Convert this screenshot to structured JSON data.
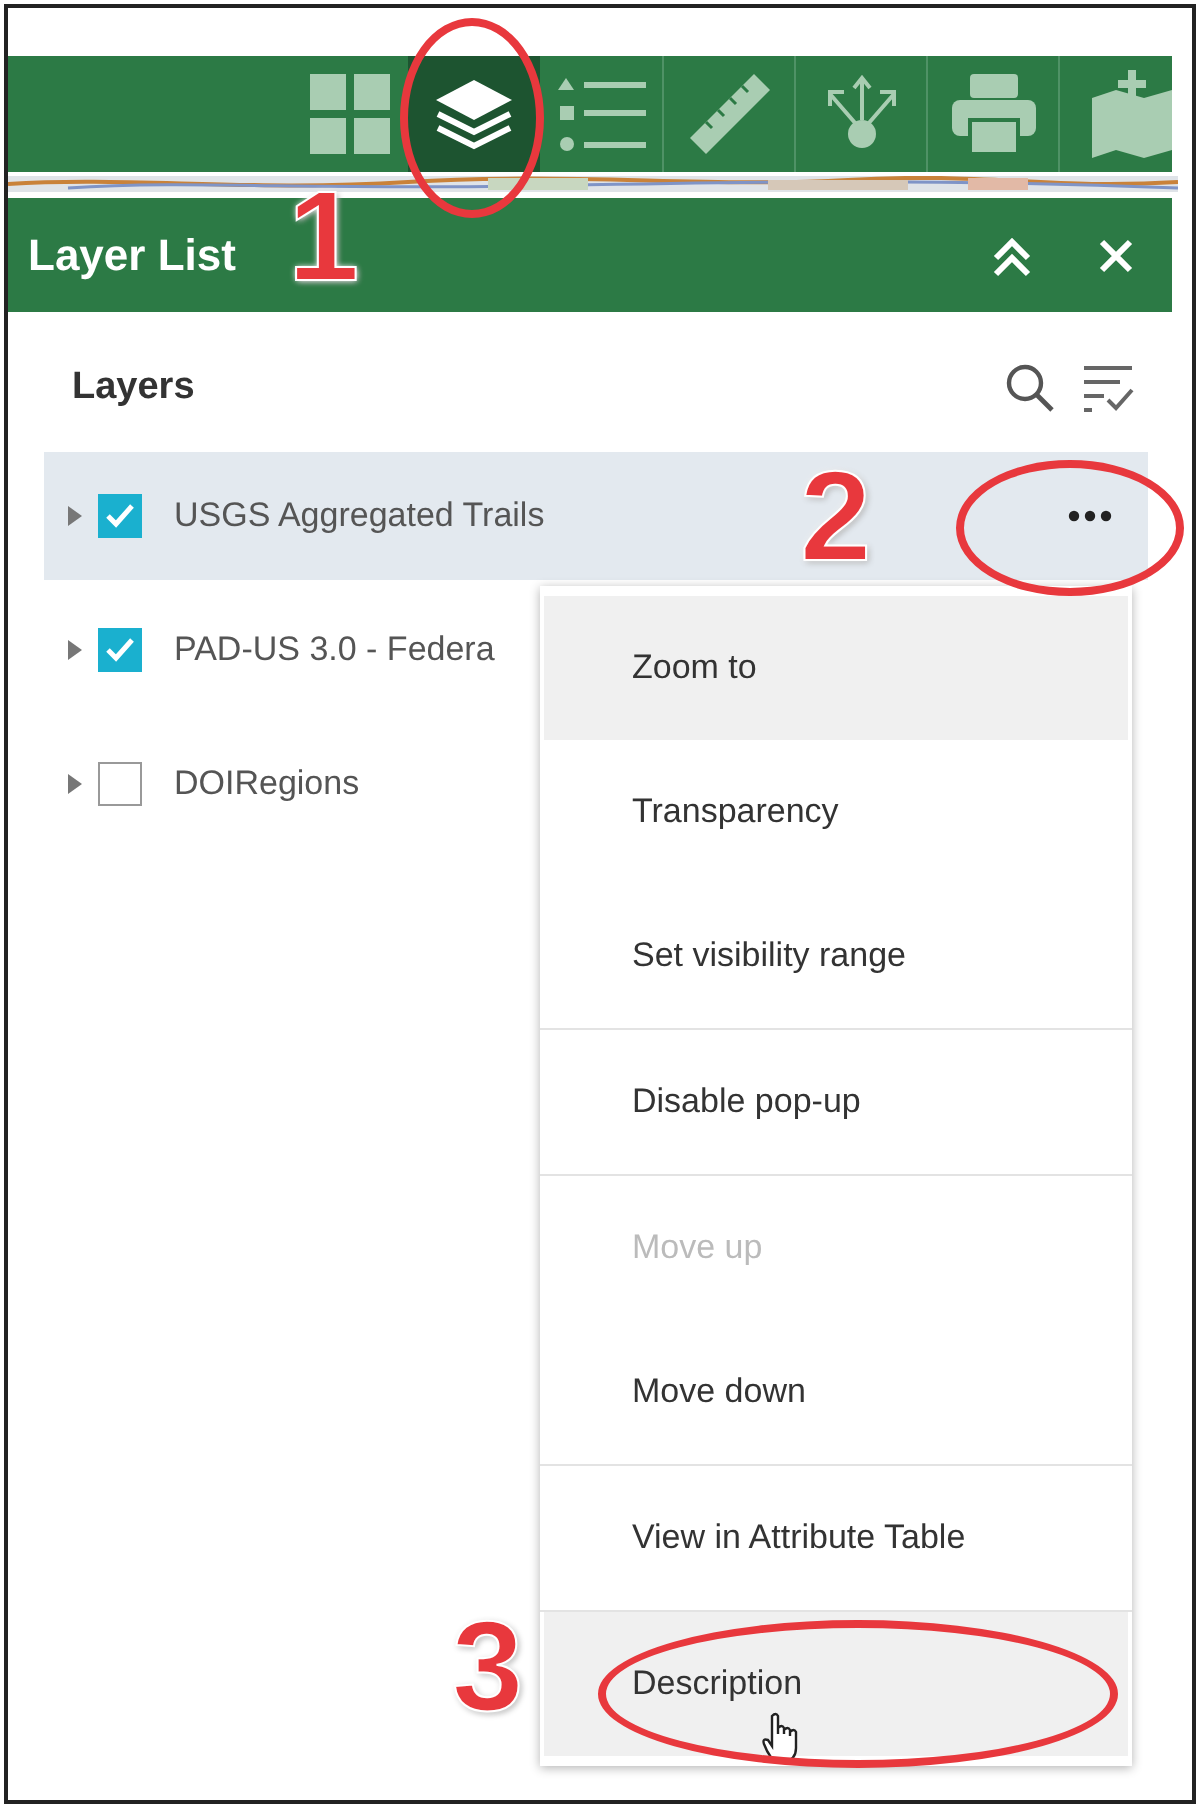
{
  "toolbar": {
    "tools": [
      {
        "kind": "grid",
        "selected": false
      },
      {
        "kind": "layers",
        "selected": true
      },
      {
        "kind": "legend",
        "selected": false
      },
      {
        "kind": "ruler",
        "selected": false
      },
      {
        "kind": "share",
        "selected": false
      },
      {
        "kind": "print",
        "selected": false
      },
      {
        "kind": "add-data",
        "selected": false
      }
    ]
  },
  "panel": {
    "title": "Layer List"
  },
  "layers": {
    "heading": "Layers",
    "items": [
      {
        "name": "USGS Aggregated Trails",
        "checked": true,
        "selected": true
      },
      {
        "name": "PAD-US 3.0 - Federa",
        "checked": true,
        "selected": false
      },
      {
        "name": "DOIRegions",
        "checked": false,
        "selected": false
      }
    ]
  },
  "menu": {
    "groups": [
      [
        {
          "label": "Zoom to",
          "disabled": false,
          "highlighted": true
        },
        {
          "label": "Transparency",
          "disabled": false,
          "highlighted": false
        },
        {
          "label": "Set visibility range",
          "disabled": false,
          "highlighted": false
        }
      ],
      [
        {
          "label": "Disable pop-up",
          "disabled": false,
          "highlighted": false
        }
      ],
      [
        {
          "label": "Move up",
          "disabled": true,
          "highlighted": false
        },
        {
          "label": "Move down",
          "disabled": false,
          "highlighted": false
        }
      ],
      [
        {
          "label": "View in Attribute Table",
          "disabled": false,
          "highlighted": false
        }
      ],
      [
        {
          "label": "Description",
          "disabled": false,
          "highlighted": true
        }
      ]
    ]
  },
  "annotations": [
    {
      "label": "1"
    },
    {
      "label": "2"
    },
    {
      "label": "3"
    }
  ]
}
